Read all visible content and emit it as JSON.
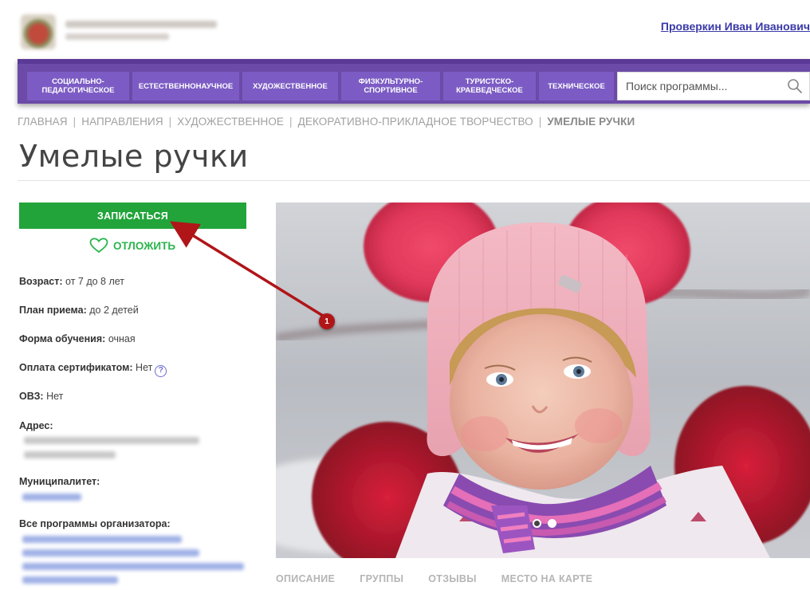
{
  "header": {
    "user_name": "Проверкин Иван Иванович"
  },
  "nav": {
    "items": [
      {
        "label": "СОЦИАЛЬНО-ПЕДАГОГИЧЕСКОЕ"
      },
      {
        "label": "ЕСТЕСТВЕННОНАУЧНОЕ"
      },
      {
        "label": "ХУДОЖЕСТВЕННОЕ"
      },
      {
        "label": "ФИЗКУЛЬТУРНО-СПОРТИВНОЕ"
      },
      {
        "label": "ТУРИСТСКО-КРАЕВЕДЧЕСКОЕ"
      },
      {
        "label": "ТЕХНИЧЕСКОЕ"
      }
    ],
    "search_placeholder": "Поиск программы..."
  },
  "breadcrumb": {
    "items": [
      "ГЛАВНАЯ",
      "НАПРАВЛЕНИЯ",
      "ХУДОЖЕСТВЕННОЕ",
      "ДЕКОРАТИВНО-ПРИКЛАДНОЕ ТВОРЧЕСТВО"
    ],
    "current": "УМЕЛЫЕ РУЧКИ"
  },
  "page": {
    "title": "Умелые ручки"
  },
  "sidebar": {
    "enroll_label": "ЗАПИСАТЬСЯ",
    "postpone_label": "ОТЛОЖИТЬ",
    "age_label": "Возраст:",
    "age_value": "от 7 до 8 лет",
    "plan_label": "План приема:",
    "plan_value": "до 2 детей",
    "form_label": "Форма обучения:",
    "form_value": "очная",
    "payment_label": "Оплата сертификатом:",
    "payment_value": "Нет",
    "help_glyph": "?",
    "ovz_label": "ОВЗ:",
    "ovz_value": "Нет",
    "address_label": "Адрес:",
    "municipality_label": "Муниципалитет:",
    "all_programs_label": "Все программы организатора:"
  },
  "tabs": [
    {
      "label": "ОПИСАНИЕ"
    },
    {
      "label": "ГРУППЫ"
    },
    {
      "label": "ОТЗЫВЫ"
    },
    {
      "label": "МЕСТО НА КАРТЕ"
    }
  ],
  "annotation": {
    "marker_number": "1",
    "color": "#b01518"
  },
  "colors": {
    "nav_bg": "#6b4aa8",
    "nav_item_bg": "#7c5cc4",
    "enroll_green": "#22a43a",
    "postpone_green": "#2bb54e",
    "link_blue": "#3a3aa8"
  }
}
